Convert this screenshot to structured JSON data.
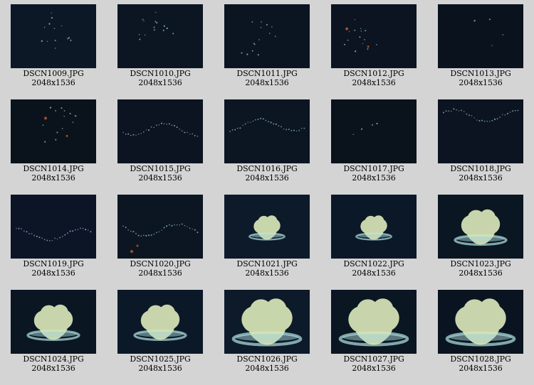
{
  "gallery": {
    "items": [
      {
        "filename": "DSCN1009.JPG",
        "dimensions": "2048x1536",
        "bg": "#0c1826",
        "subject": "sparse"
      },
      {
        "filename": "DSCN1010.JPG",
        "dimensions": "2048x1536",
        "bg": "#0b1622",
        "subject": "sparse"
      },
      {
        "filename": "DSCN1011.JPG",
        "dimensions": "2048x1536",
        "bg": "#0b1521",
        "subject": "sparse"
      },
      {
        "filename": "DSCN1012.JPG",
        "dimensions": "2048x1536",
        "bg": "#0b1420",
        "subject": "sparse-orange"
      },
      {
        "filename": "DSCN1013.JPG",
        "dimensions": "2048x1536",
        "bg": "#0a131d",
        "subject": "empty"
      },
      {
        "filename": "DSCN1014.JPG",
        "dimensions": "2048x1536",
        "bg": "#0a121b",
        "subject": "sparse-orange"
      },
      {
        "filename": "DSCN1015.JPG",
        "dimensions": "2048x1536",
        "bg": "#0b1420",
        "subject": "chain"
      },
      {
        "filename": "DSCN1016.JPG",
        "dimensions": "2048x1536",
        "bg": "#0b1622",
        "subject": "chain"
      },
      {
        "filename": "DSCN1017.JPG",
        "dimensions": "2048x1536",
        "bg": "#0a121b",
        "subject": "empty"
      },
      {
        "filename": "DSCN1018.JPG",
        "dimensions": "2048x1536",
        "bg": "#0b1420",
        "subject": "chain"
      },
      {
        "filename": "DSCN1019.JPG",
        "dimensions": "2048x1536",
        "bg": "#0c1526",
        "subject": "chain"
      },
      {
        "filename": "DSCN1020.JPG",
        "dimensions": "2048x1536",
        "bg": "#0b1622",
        "subject": "chain-orange"
      },
      {
        "filename": "DSCN1021.JPG",
        "dimensions": "2048x1536",
        "bg": "#0c1a2a",
        "subject": "jelly-small"
      },
      {
        "filename": "DSCN1022.JPG",
        "dimensions": "2048x1536",
        "bg": "#0b1828",
        "subject": "jelly-small"
      },
      {
        "filename": "DSCN1023.JPG",
        "dimensions": "2048x1536",
        "bg": "#0a1622",
        "subject": "jelly-medium"
      },
      {
        "filename": "DSCN1024.JPG",
        "dimensions": "2048x1536",
        "bg": "#0a1622",
        "subject": "jelly-medium"
      },
      {
        "filename": "DSCN1025.JPG",
        "dimensions": "2048x1536",
        "bg": "#0b1828",
        "subject": "jelly-medium"
      },
      {
        "filename": "DSCN1026.JPG",
        "dimensions": "2048x1536",
        "bg": "#0c1a2a",
        "subject": "jelly-large"
      },
      {
        "filename": "DSCN1027.JPG",
        "dimensions": "2048x1536",
        "bg": "#0a1622",
        "subject": "jelly-large"
      },
      {
        "filename": "DSCN1028.JPG",
        "dimensions": "2048x1536",
        "bg": "#0a1420",
        "subject": "jelly-large"
      }
    ]
  },
  "colors": {
    "page_background": "#d4d4d4",
    "jelly_body": "#d9e6b8",
    "jelly_ring": "#a8d8d8",
    "speck": "#8fb4c8",
    "speck_orange": "#c0602a"
  }
}
